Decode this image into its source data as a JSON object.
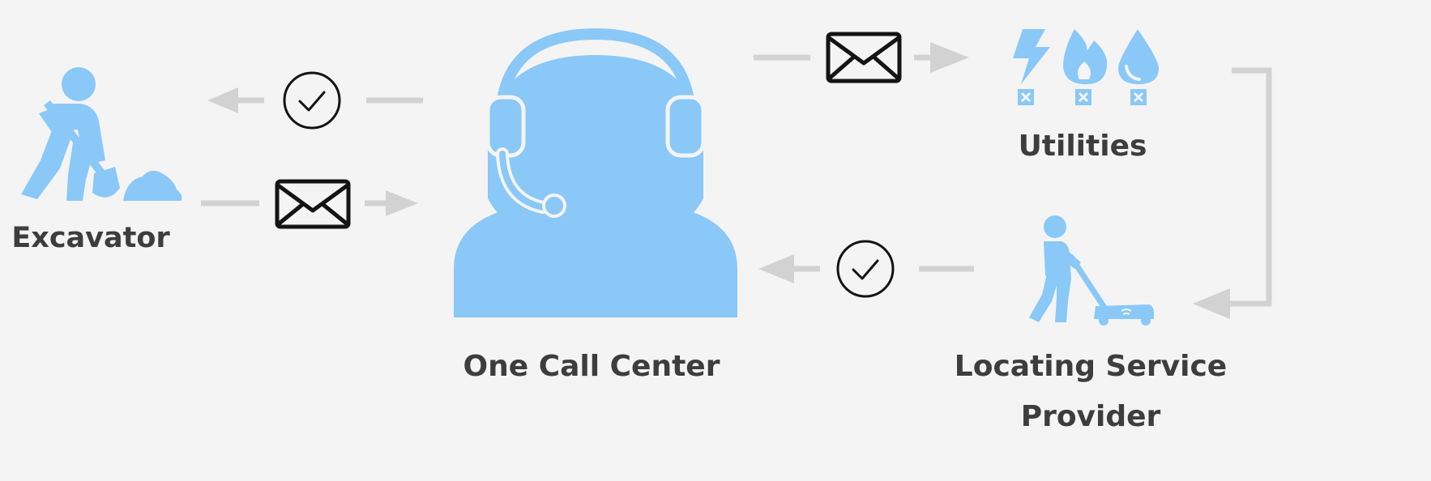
{
  "labels": {
    "excavator": "Excavator",
    "one_call_center": "One Call Center",
    "utilities": "Utilities",
    "locating_line1": "Locating Service",
    "locating_line2": "Provider"
  },
  "colors": {
    "icon_blue": "#8ac8f7",
    "arrow_gray": "#d2d2d2",
    "symbol_black": "#141414",
    "label_text": "#3d3d3d",
    "background": "#f4f4f4"
  },
  "icons": {
    "excavator": "digging-worker-icon",
    "one_call_center": "headset-operator-icon",
    "utilities": [
      "electric-bolt-icon",
      "gas-flame-icon",
      "water-drop-icon"
    ],
    "locating_service": "ground-locator-worker-icon",
    "message": "envelope-icon",
    "confirmation": "check-circle-icon"
  }
}
